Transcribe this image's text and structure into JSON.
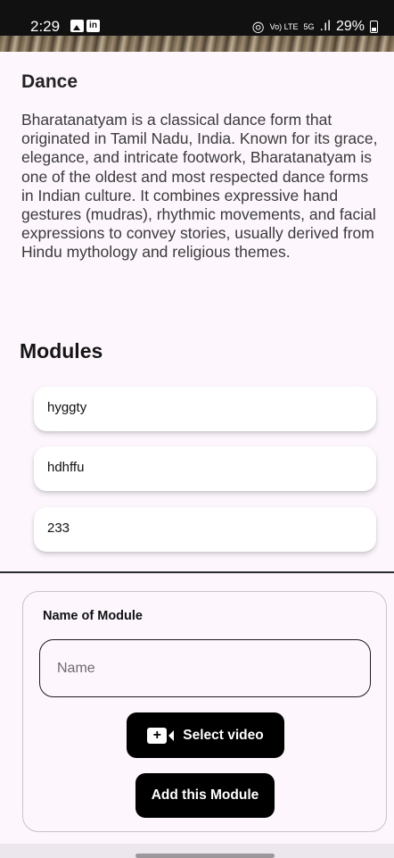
{
  "status_bar": {
    "time": "2:29",
    "right_text": "29%",
    "icons": [
      "gallery-icon",
      "linkedin-icon",
      "hotspot-icon",
      "volte-icon",
      "5g-icon",
      "signal-icon",
      "battery-icon"
    ],
    "linkedin_glyph": "in",
    "hotspot_glyph": "◎",
    "volte_glyph": "Vo) LTE",
    "fiveg_glyph": "5G",
    "signal_glyph": ".ıl"
  },
  "course": {
    "title": "Dance",
    "description": "Bharatanatyam is a classical dance form that originated in Tamil Nadu, India. Known for its grace, elegance, and intricate footwork, Bharatanatyam is one of the oldest and most respected dance forms in Indian culture. It combines expressive hand gestures (mudras), rhythmic movements, and facial expressions to convey stories, usually derived from Hindu mythology and religious themes."
  },
  "modules": {
    "heading": "Modules",
    "items": [
      {
        "name": "hyggty"
      },
      {
        "name": "hdhffu"
      },
      {
        "name": "233"
      }
    ]
  },
  "add_module": {
    "label": "Name of Module",
    "input_value": "",
    "input_placeholder": "Name",
    "select_video_label": "Select video",
    "add_button_label": "Add this Module",
    "video_icon_glyph": "+"
  },
  "colors": {
    "background": "#fdf7fd",
    "button": "#000000",
    "card": "#ffffff"
  }
}
